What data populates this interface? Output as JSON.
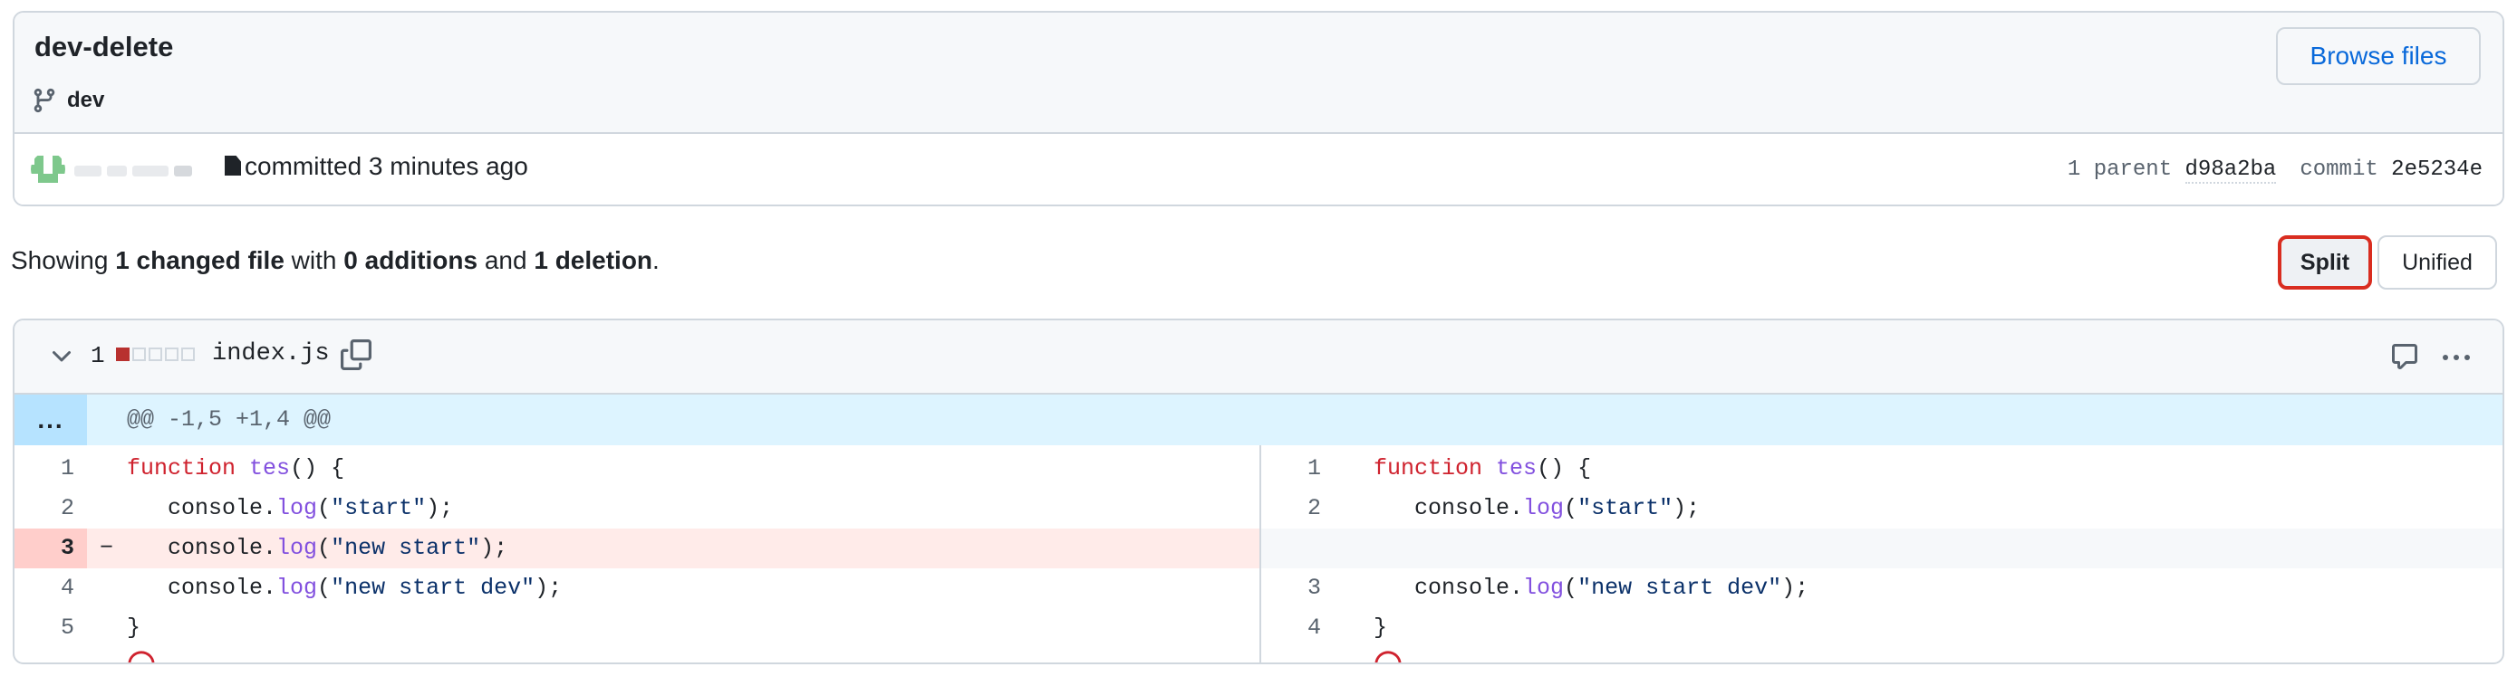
{
  "commit": {
    "title": "dev-delete",
    "branch": "dev",
    "browse_files_label": "Browse files",
    "committed_text": "committed 3 minutes ago",
    "parent_label": "1 parent",
    "parent_sha": "d98a2ba",
    "commit_label": "commit",
    "commit_sha": "2e5234e"
  },
  "summary": {
    "prefix": "Showing ",
    "changed_files": "1 changed file",
    "with": " with ",
    "additions": "0 additions",
    "and": " and ",
    "deletions": "1 deletion",
    "suffix": "."
  },
  "view_toggle": {
    "split_label": "Split",
    "unified_label": "Unified",
    "selected": "Split"
  },
  "file": {
    "change_count": "1",
    "name": "index.js",
    "hunk_expand": "...",
    "hunk_header": "@@ -1,5 +1,4 @@"
  },
  "diff": {
    "left": [
      {
        "ln": "1",
        "marker": "",
        "type": "ctx",
        "tokens": [
          {
            "t": "function",
            "c": "kw"
          },
          {
            "t": " "
          },
          {
            "t": "tes",
            "c": "fn"
          },
          {
            "t": "() {"
          }
        ]
      },
      {
        "ln": "2",
        "marker": "",
        "type": "ctx",
        "tokens": [
          {
            "t": "   console."
          },
          {
            "t": "log",
            "c": "fn"
          },
          {
            "t": "("
          },
          {
            "t": "\"start\"",
            "c": "str"
          },
          {
            "t": ");"
          }
        ]
      },
      {
        "ln": "3",
        "marker": "−",
        "type": "del",
        "tokens": [
          {
            "t": "   console."
          },
          {
            "t": "log",
            "c": "fn"
          },
          {
            "t": "("
          },
          {
            "t": "\"new start\"",
            "c": "str"
          },
          {
            "t": ");"
          }
        ]
      },
      {
        "ln": "4",
        "marker": "",
        "type": "ctx",
        "tokens": [
          {
            "t": "   console."
          },
          {
            "t": "log",
            "c": "fn"
          },
          {
            "t": "("
          },
          {
            "t": "\"new start dev\"",
            "c": "str"
          },
          {
            "t": ");"
          }
        ]
      },
      {
        "ln": "5",
        "marker": "",
        "type": "ctx",
        "tokens": [
          {
            "t": "}"
          }
        ]
      }
    ],
    "right": [
      {
        "ln": "1",
        "marker": "",
        "type": "ctx",
        "tokens": [
          {
            "t": "function",
            "c": "kw"
          },
          {
            "t": " "
          },
          {
            "t": "tes",
            "c": "fn"
          },
          {
            "t": "() {"
          }
        ]
      },
      {
        "ln": "2",
        "marker": "",
        "type": "ctx",
        "tokens": [
          {
            "t": "   console."
          },
          {
            "t": "log",
            "c": "fn"
          },
          {
            "t": "("
          },
          {
            "t": "\"start\"",
            "c": "str"
          },
          {
            "t": ");"
          }
        ]
      },
      {
        "ln": "",
        "marker": "",
        "type": "empty",
        "tokens": []
      },
      {
        "ln": "3",
        "marker": "",
        "type": "ctx",
        "tokens": [
          {
            "t": "   console."
          },
          {
            "t": "log",
            "c": "fn"
          },
          {
            "t": "("
          },
          {
            "t": "\"new start dev\"",
            "c": "str"
          },
          {
            "t": ");"
          }
        ]
      },
      {
        "ln": "4",
        "marker": "",
        "type": "ctx",
        "tokens": [
          {
            "t": "}"
          }
        ]
      }
    ]
  },
  "icons": {
    "branch": "git-branch-icon",
    "chevron": "chevron-down-icon",
    "copy": "copy-icon",
    "comment": "comment-icon",
    "kebab": "kebab-horizontal-icon",
    "no_newline": "no-entry-icon"
  },
  "colors": {
    "accent": "#0969da",
    "deletion": "#b8312f",
    "del_line_bg": "#ffebe9",
    "del_num_bg": "#ffcecb",
    "hunk_bg": "#ddf4ff",
    "highlight_border": "#d92d20"
  }
}
